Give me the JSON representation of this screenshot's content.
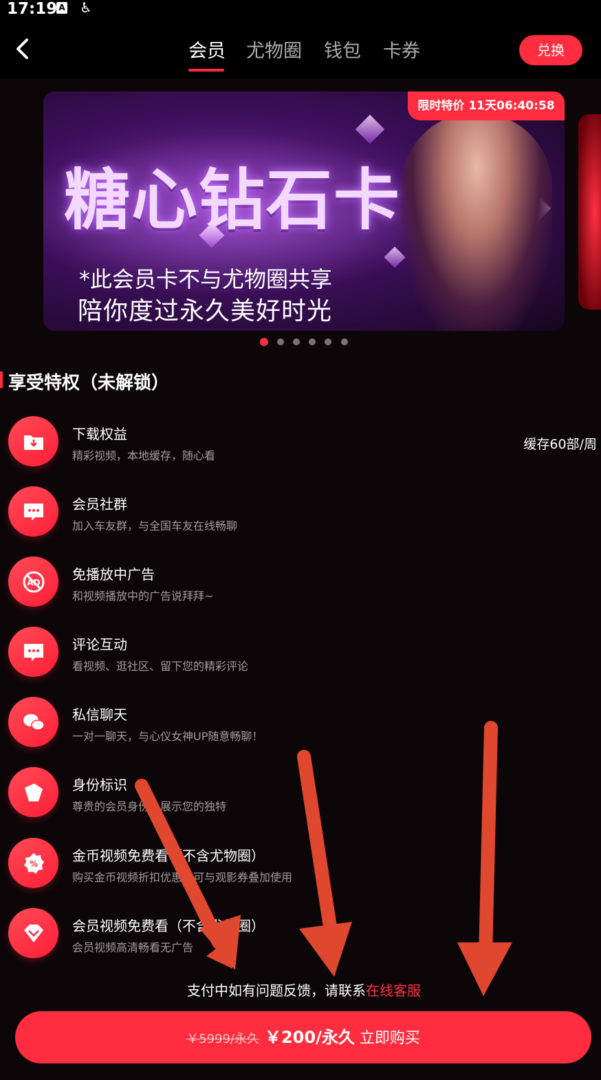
{
  "status_bar": {
    "time": "17:19",
    "icons": [
      "a-notification-icon",
      "accessibility-icon"
    ]
  },
  "nav": {
    "back_icon": "back-chevron-icon",
    "tabs": [
      {
        "label": "会员",
        "active": true
      },
      {
        "label": "尤物圈",
        "active": false
      },
      {
        "label": "钱包",
        "active": false
      },
      {
        "label": "卡券",
        "active": false
      }
    ],
    "redeem_label": "兑换"
  },
  "banner": {
    "title": "糖心钻石卡",
    "line1": "*此会员卡不与尤物圈共享",
    "line2": "陪你度过永久美好时光",
    "promo": "限时特价 11天06:40:58",
    "dots_count": 6,
    "active_dot": 0
  },
  "section_title": "享受特权（未解锁）",
  "privileges": [
    {
      "icon": "download-folder-icon",
      "title": "下载权益",
      "desc": "精彩视频，本地缓存，随心看",
      "right": "缓存60部/周"
    },
    {
      "icon": "chat-bubble-icon",
      "title": "会员社群",
      "desc": "加入车友群，与全国车友在线畅聊",
      "right": ""
    },
    {
      "icon": "no-ad-icon",
      "title": "免播放中广告",
      "desc": "和视频播放中的广告说拜拜~",
      "right": ""
    },
    {
      "icon": "comment-icon",
      "title": "评论互动",
      "desc": "看视频、逛社区、留下您的精彩评论",
      "right": ""
    },
    {
      "icon": "private-message-icon",
      "title": "私信聊天",
      "desc": "一对一聊天，与心仪女神UP随意畅聊！",
      "right": ""
    },
    {
      "icon": "id-tag-icon",
      "title": "身份标识",
      "desc": "尊贵的会员身份，展示您的独特",
      "right": ""
    },
    {
      "icon": "discount-badge-icon",
      "title": "金币视频免费看（不含尤物圈）",
      "desc": "购买金币视频折扣优惠，可与观影券叠加使用",
      "right": ""
    },
    {
      "icon": "vip-gem-icon",
      "title": "会员视频免费看（不含尤物圈）",
      "desc": "会员视频高清畅看无广告",
      "right": ""
    }
  ],
  "notice": {
    "text": "支付中如有问题反馈，请联系",
    "link": "在线客服"
  },
  "buy": {
    "old_price": "￥5999/永久",
    "new_price": "￥200/永久",
    "action": "立即购买"
  },
  "colors": {
    "accent": "#ff2d3f",
    "background": "#0d0608",
    "annotation_arrow": "#e0472f"
  }
}
